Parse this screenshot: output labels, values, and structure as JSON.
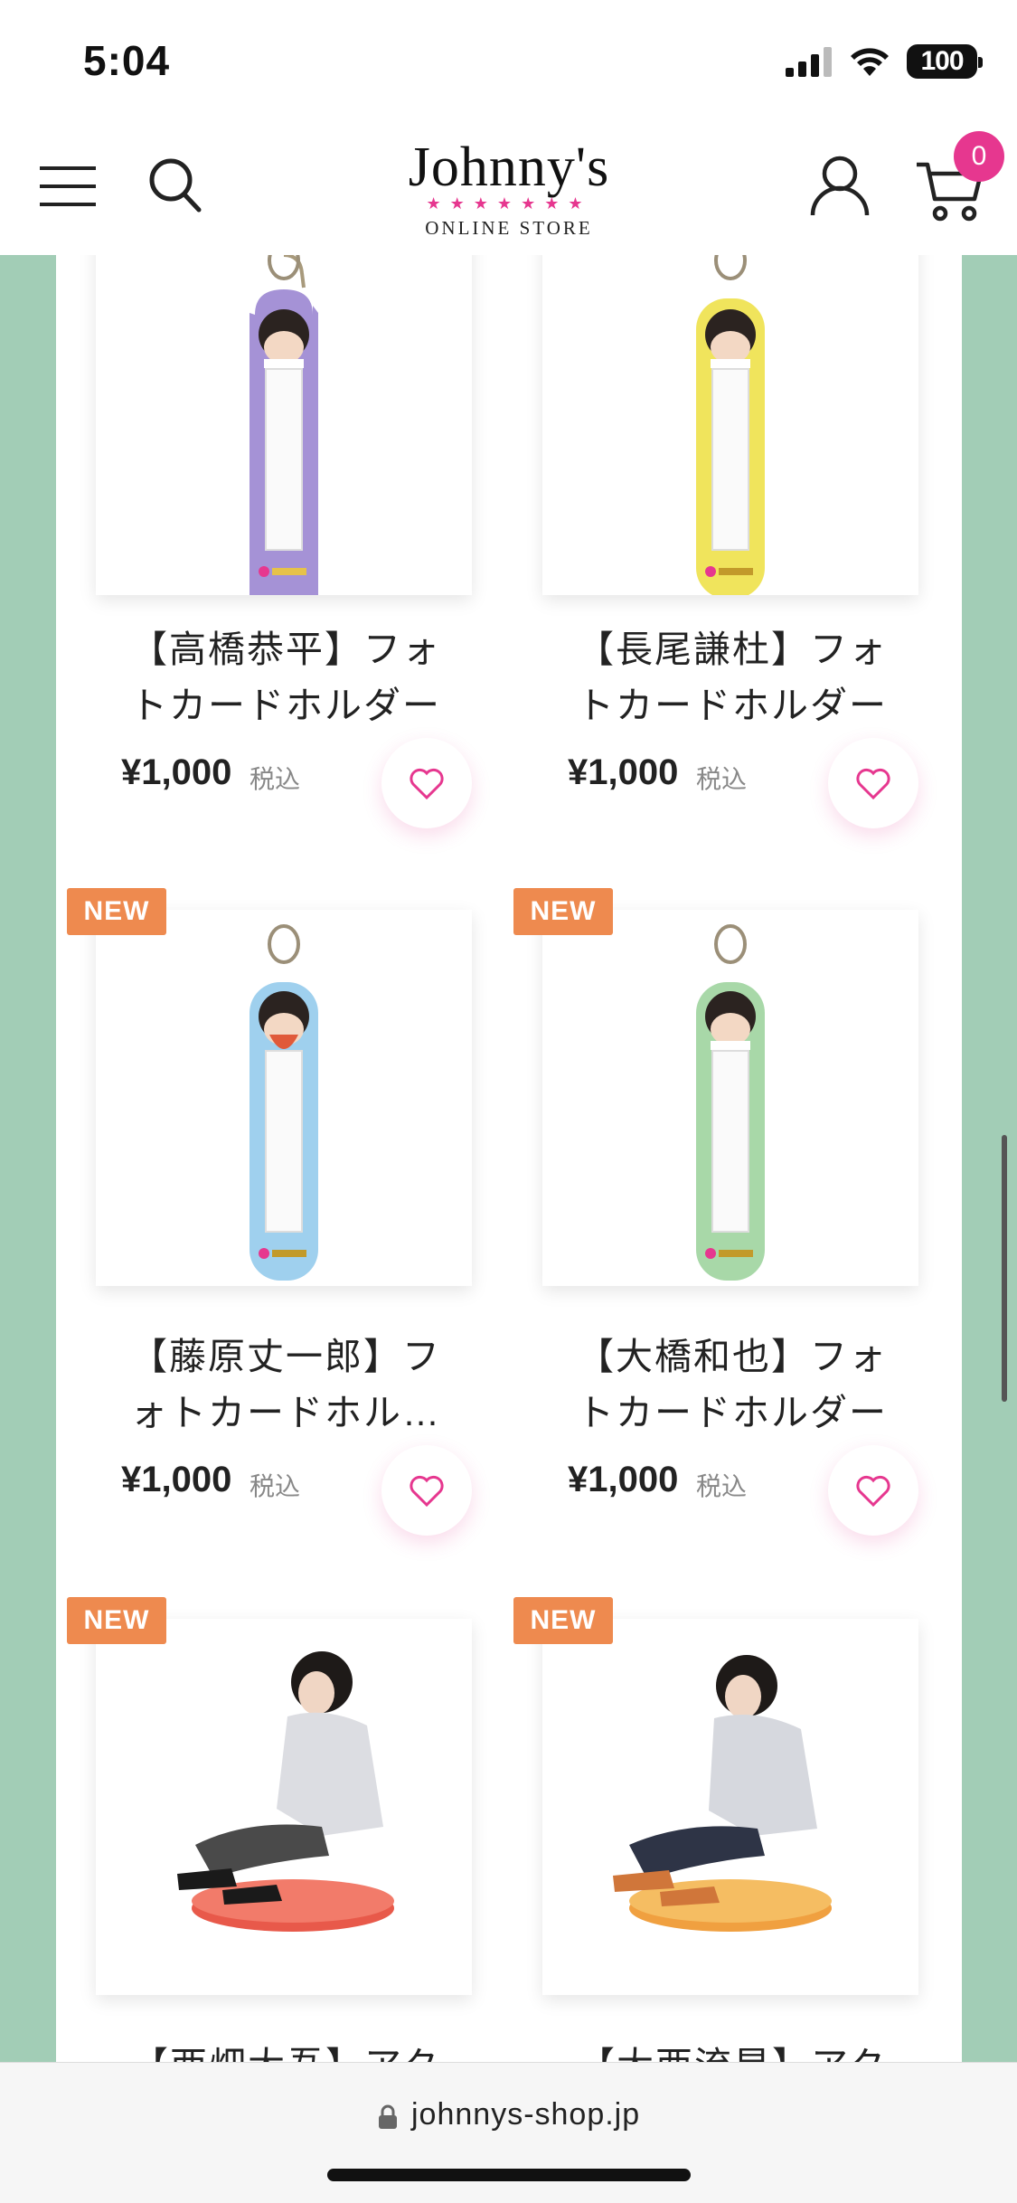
{
  "status_bar": {
    "time": "5:04",
    "battery": "100"
  },
  "header": {
    "logo_main": "Johnny's",
    "logo_stars": "★★★★★★★",
    "logo_sub": "ONLINE STORE",
    "cart_count": "0"
  },
  "products": [
    {
      "name_line1": "【高橋恭平】フォ",
      "name_line2": "トカードホルダー",
      "price": "¥1,000",
      "tax_label": "税込",
      "is_new": false,
      "holder_color": "#a592d6",
      "visual": "keychain"
    },
    {
      "name_line1": "【長尾謙杜】フォ",
      "name_line2": "トカードホルダー",
      "price": "¥1,000",
      "tax_label": "税込",
      "is_new": false,
      "holder_color": "#f0e45c",
      "visual": "keychain"
    },
    {
      "name_line1": "【藤原丈一郎】フ",
      "name_line2": "ォトカードホル…",
      "price": "¥1,000",
      "tax_label": "税込",
      "is_new": true,
      "new_label": "NEW",
      "holder_color": "#9fd0ee",
      "visual": "keychain"
    },
    {
      "name_line1": "【大橋和也】フォ",
      "name_line2": "トカードホルダー",
      "price": "¥1,000",
      "tax_label": "税込",
      "is_new": true,
      "new_label": "NEW",
      "holder_color": "#a8d8a8",
      "visual": "keychain"
    },
    {
      "name_line1": "【西畑大吾】アク",
      "is_new": true,
      "new_label": "NEW",
      "base_color": "#e8594a",
      "visual": "acrylic-stand"
    },
    {
      "name_line1": "【大西流星】アク",
      "is_new": true,
      "new_label": "NEW",
      "base_color": "#f0a040",
      "visual": "acrylic-stand"
    }
  ],
  "url_bar": {
    "domain": "johnnys-shop.jp"
  },
  "colors": {
    "accent_pink": "#e6378f",
    "new_badge": "#ee8a4f",
    "frame_green": "#a2cdb6"
  }
}
